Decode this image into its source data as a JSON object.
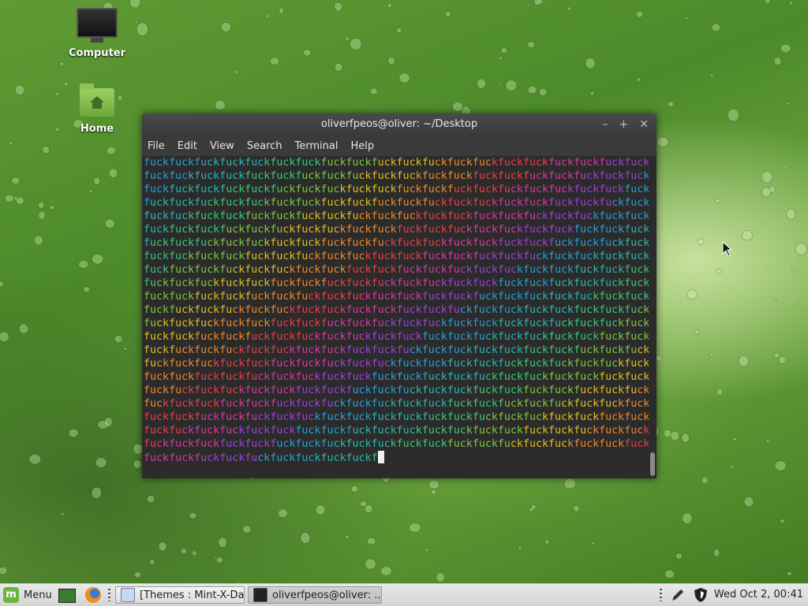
{
  "desktop": {
    "icons": [
      {
        "label": "Computer",
        "icon": "computer-icon"
      },
      {
        "label": "Home",
        "icon": "home-folder-icon"
      }
    ]
  },
  "terminal": {
    "title": "oliverfpeos@oliver: ~/Desktop",
    "menu": [
      "File",
      "Edit",
      "View",
      "Search",
      "Terminal",
      "Help"
    ],
    "repeated_word": "fuck",
    "full_line_text": "fuckfuckfuckfuckfuckfuckfuckfuckfuckfuckfuckfuckfuckfuckfuckfuckfuckfuckfuckfuck",
    "last_line_text": "fuckfuckfuckfuckfuckfuckfuckfuckfuckf",
    "colors": {
      "background": "#2b2b2b",
      "rainbow": [
        "#2a9fd6",
        "#2bb8b0",
        "#3cc97a",
        "#7fc93c",
        "#e0c020",
        "#f08a2a",
        "#e8404a",
        "#d83aa0",
        "#a040d8"
      ]
    }
  },
  "panel": {
    "menu_label": "Menu",
    "tasks": [
      {
        "label": "[Themes : Mint-X-Da...",
        "icon": "document-viewer-icon"
      },
      {
        "label": "oliverfpeos@oliver: ...",
        "icon": "terminal-icon"
      }
    ],
    "clock": "Wed Oct  2, 00:41"
  }
}
